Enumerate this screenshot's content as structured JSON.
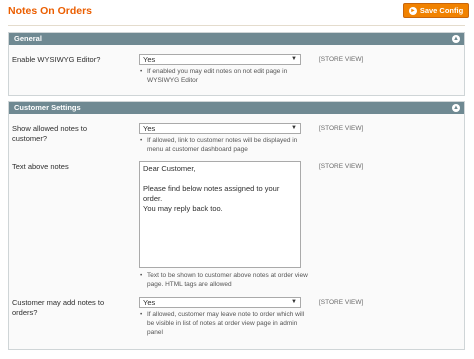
{
  "page": {
    "title": "Notes On Orders",
    "save_label": "Save Config"
  },
  "general": {
    "title": "General",
    "wysiwyg_label": "Enable WYSIWYG Editor?",
    "wysiwyg_value": "Yes",
    "wysiwyg_note": "If enabled you may edit notes on not edit page in WYSIWYG Editor",
    "wysiwyg_scope": "[STORE VIEW]"
  },
  "customer": {
    "title": "Customer Settings",
    "show_label": "Show allowed notes to customer?",
    "show_value": "Yes",
    "show_note": "If allowed, link to customer notes will be displayed in menu at customer dashboard page",
    "show_scope": "[STORE VIEW]",
    "text_label": "Text above notes",
    "text_value": "Dear Customer,\n\nPlease find below notes assigned to your order.\nYou may reply back too.",
    "text_note": "Text to be shown to customer above notes at order view page. HTML tags are allowed",
    "text_scope": "[STORE VIEW]",
    "add_label": "Customer may add notes to orders?",
    "add_value": "Yes",
    "add_note": "If allowed, customer may leave note to order which will be visible in list of notes at order view page in admin panel",
    "add_scope": "[STORE VIEW]"
  },
  "icons": {
    "save": "save-icon",
    "collapse": "collapse-icon",
    "dropdown": "chevron-down-icon"
  },
  "colors": {
    "accent": "#eb5e00",
    "button": "#f18200",
    "section_header": "#6f8992"
  }
}
